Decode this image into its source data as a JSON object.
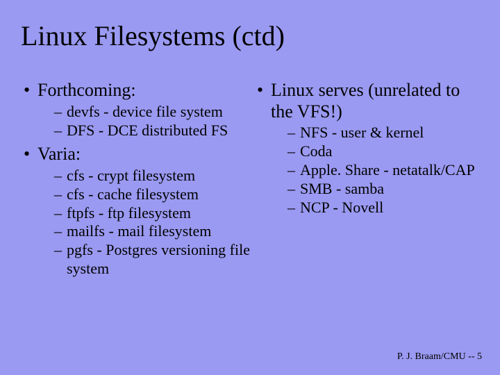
{
  "title": "Linux Filesystems (ctd)",
  "left": {
    "h1": "Forthcoming:",
    "sub1": [
      "devfs - device file system",
      "DFS - DCE distributed FS"
    ],
    "h2": "Varia:",
    "sub2": [
      "cfs - crypt filesystem",
      "cfs - cache filesystem",
      "ftpfs - ftp filesystem",
      "mailfs - mail filesystem",
      "pgfs - Postgres versioning file system"
    ]
  },
  "right": {
    "h1": "Linux serves (unrelated to the VFS!)",
    "sub1": [
      "NFS - user & kernel",
      "Coda",
      "Apple. Share - netatalk/CAP",
      "SMB - samba",
      "NCP - Novell"
    ]
  },
  "footer": "P. J. Braam/CMU  -- 5"
}
